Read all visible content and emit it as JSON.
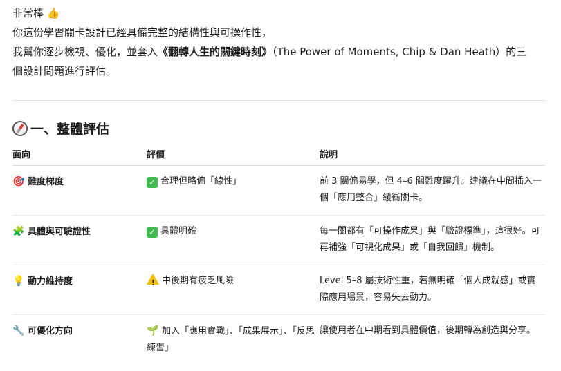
{
  "intro": {
    "line1": "非常棒",
    "line1_emoji": "👍",
    "line2": "你這份學習關卡設計已經具備完整的結構性與可操作性，",
    "line3_pre": "我幫你逐步檢視、優化，並套入",
    "line3_bold": "《翻轉人生的關鍵時刻》",
    "line3_post": "（The Power of Moments, Chip & Dan Heath）的三",
    "line4": "個設計問題進行評估。"
  },
  "section": {
    "icon": "compass-icon",
    "title": "一、整體評估"
  },
  "table": {
    "headers": [
      "面向",
      "評價",
      "說明"
    ],
    "rows": [
      {
        "icon": "🎯",
        "aspect": "難度梯度",
        "eval_icon": "check",
        "eval": "合理但略偏「線性」",
        "desc": "前 3 關偏易學，但 4–6 關難度躍升。建議在中間插入一個「應用整合」緩衝關卡。"
      },
      {
        "icon": "🧩",
        "aspect": "具體與可驗證性",
        "eval_icon": "check",
        "eval": "具體明確",
        "desc": "每一關都有「可操作成果」與「驗證標準」，這很好。可再補強「可視化成果」或「自我回饋」機制。"
      },
      {
        "icon": "💡",
        "aspect": "動力維持度",
        "eval_icon": "warning",
        "eval": "中後期有疲乏風險",
        "desc": "Level 5–8 屬技術性重，若無明確「個人成就感」或實際應用場景，容易失去動力。"
      },
      {
        "icon": "🔧",
        "aspect": "可優化方向",
        "eval_icon": "🌱",
        "eval": "加入「應用實戰」、「成果展示」、「反思練習」",
        "desc": "讓使用者在中期看到具體價值，後期轉為創造與分享。"
      }
    ]
  }
}
